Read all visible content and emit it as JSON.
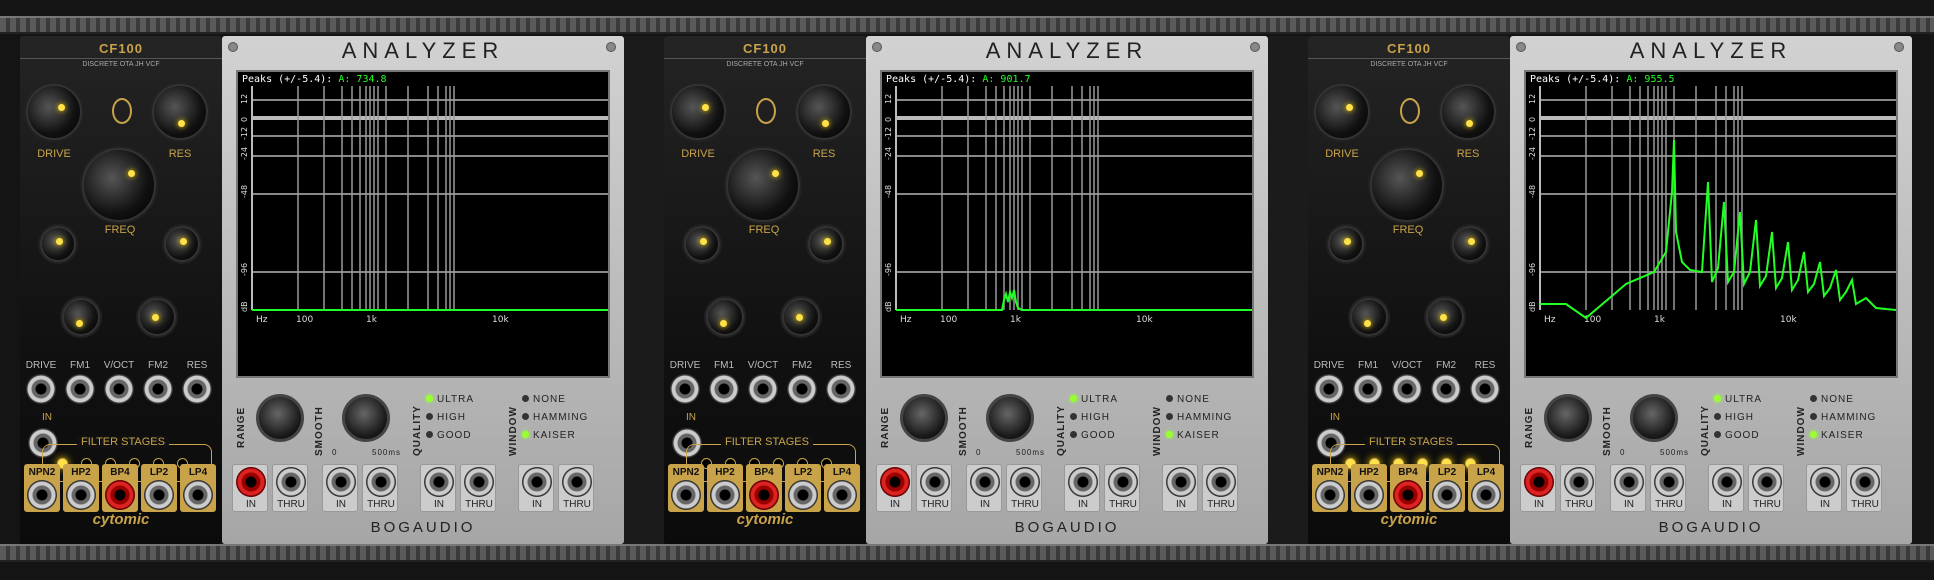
{
  "cf100": {
    "title": "CF100",
    "subtitle": "DISCRETE OTA JH VCF",
    "knob_labels": {
      "drive": "DRIVE",
      "res": "RES",
      "freq": "FREQ"
    },
    "jack_labels": [
      "DRIVE",
      "FM1",
      "V/OCT",
      "FM2",
      "RES"
    ],
    "in_label": "IN",
    "filter_stages_label": "FILTER STAGES",
    "outputs": [
      "NPN2",
      "HP2",
      "BP4",
      "LP2",
      "LP4"
    ],
    "brand": "cytomic"
  },
  "analyzer": {
    "title": "ANALYZER",
    "brand": "BOGAUDIO",
    "peaks_label": "Peaks (+/-5.4):",
    "channel": "A:",
    "db_ticks": [
      "12",
      "0",
      "-12",
      "-24",
      "-48",
      "-96",
      "dB"
    ],
    "freq_ticks": [
      "Hz",
      "100",
      "1k",
      "10k"
    ],
    "range_label": "RANGE",
    "smooth_label": "SMOOTH",
    "smooth_min": "0",
    "smooth_max": "500ms",
    "quality_label": "QUALITY",
    "quality_options": [
      "ULTRA",
      "HIGH",
      "GOOD"
    ],
    "window_label": "WINDOW",
    "window_options": [
      "NONE",
      "HAMMING",
      "KAISER"
    ],
    "jack_in": "IN",
    "jack_thru": "THRU"
  },
  "instances": [
    {
      "peak_value": "734.8",
      "active_stage_leds": 1
    },
    {
      "peak_value": "901.7",
      "active_stage_leds": 0
    },
    {
      "peak_value": "955.5",
      "active_stage_leds": 6
    }
  ],
  "colors": {
    "gold": "#c9a34a",
    "trace": "#22ff22",
    "led_yellow": "#ffe24a",
    "cable_red": "#cc2222"
  }
}
